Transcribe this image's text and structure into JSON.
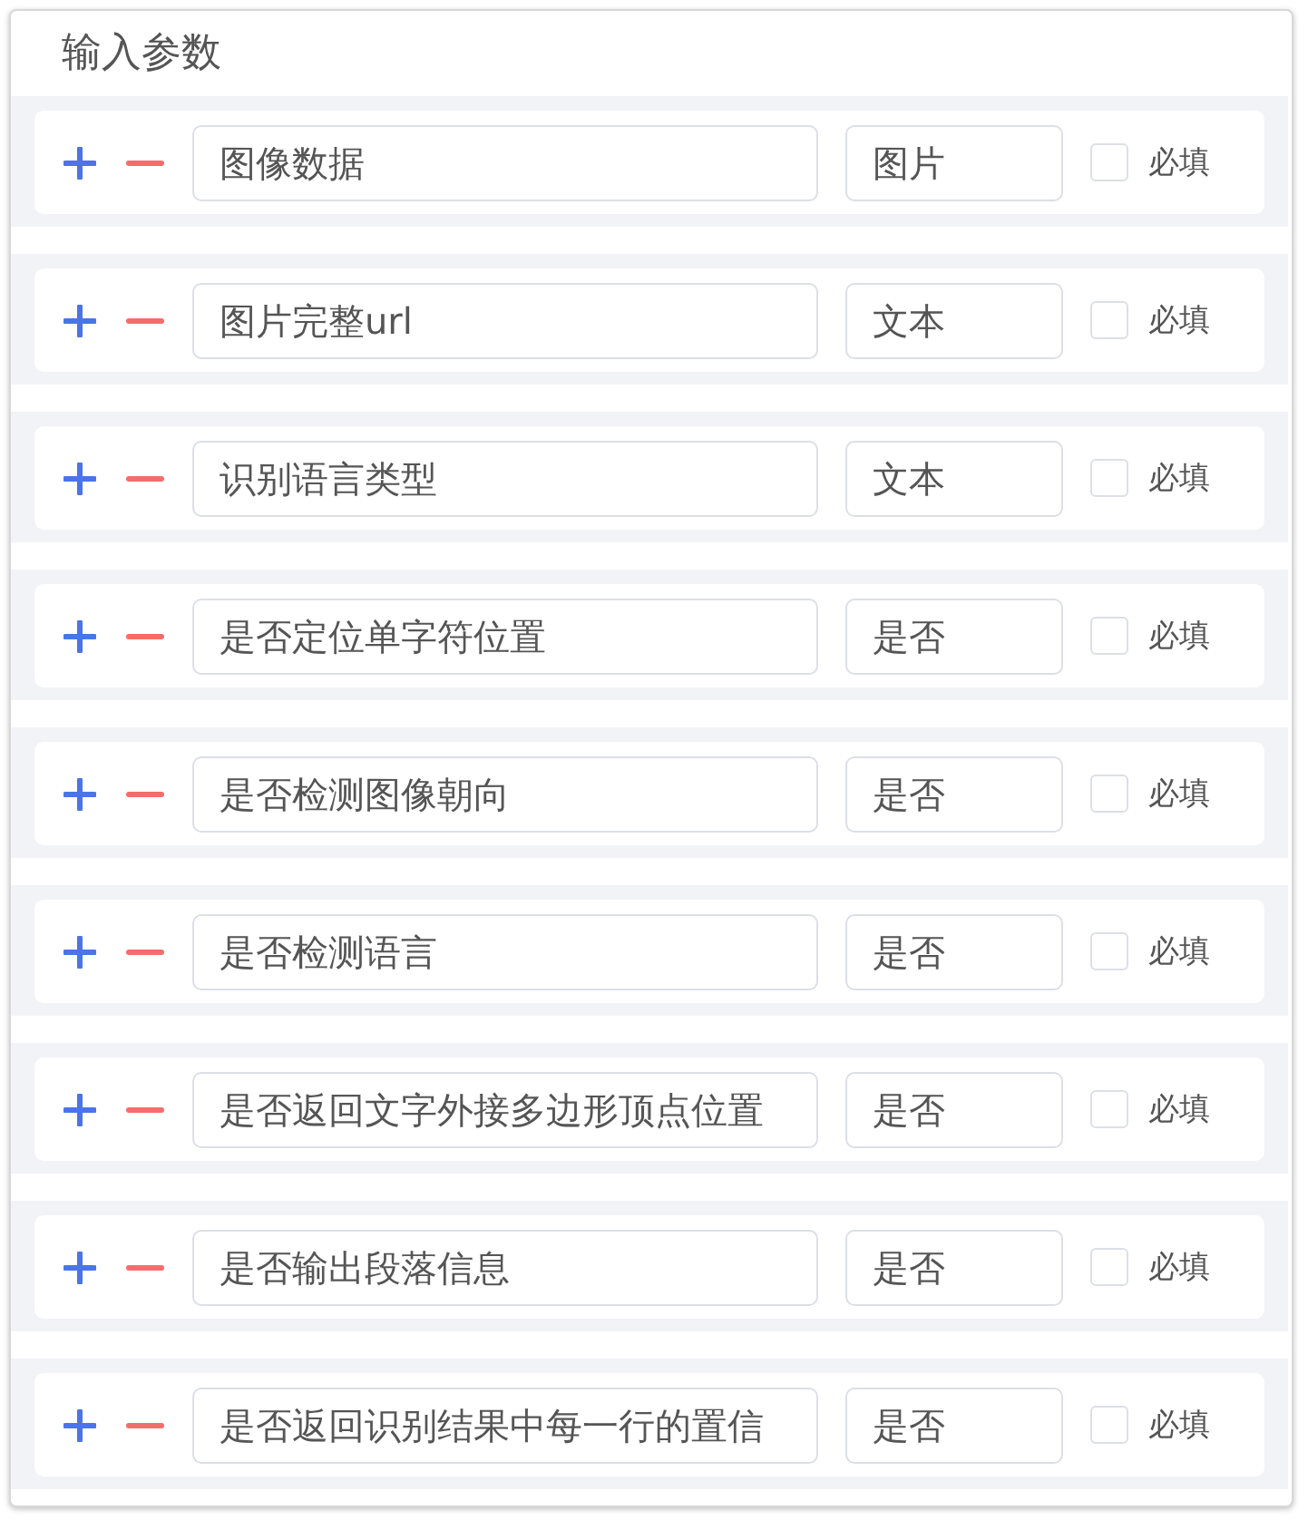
{
  "title": "输入参数",
  "params": [
    {
      "name": "图像数据",
      "type": "图片",
      "required_label": "必填",
      "checked": false
    },
    {
      "name": "图片完整url",
      "type": "文本",
      "required_label": "必填",
      "checked": false
    },
    {
      "name": "识别语言类型",
      "type": "文本",
      "required_label": "必填",
      "checked": false
    },
    {
      "name": "是否定位单字符位置",
      "type": "是否",
      "required_label": "必填",
      "checked": false
    },
    {
      "name": "是否检测图像朝向",
      "type": "是否",
      "required_label": "必填",
      "checked": false
    },
    {
      "name": "是否检测语言",
      "type": "是否",
      "required_label": "必填",
      "checked": false
    },
    {
      "name": "是否返回文字外接多边形顶点位置",
      "type": "是否",
      "required_label": "必填",
      "checked": false
    },
    {
      "name": "是否输出段落信息",
      "type": "是否",
      "required_label": "必填",
      "checked": false
    },
    {
      "name": "是否返回识别结果中每一行的置信",
      "type": "是否",
      "required_label": "必填",
      "checked": false
    }
  ]
}
